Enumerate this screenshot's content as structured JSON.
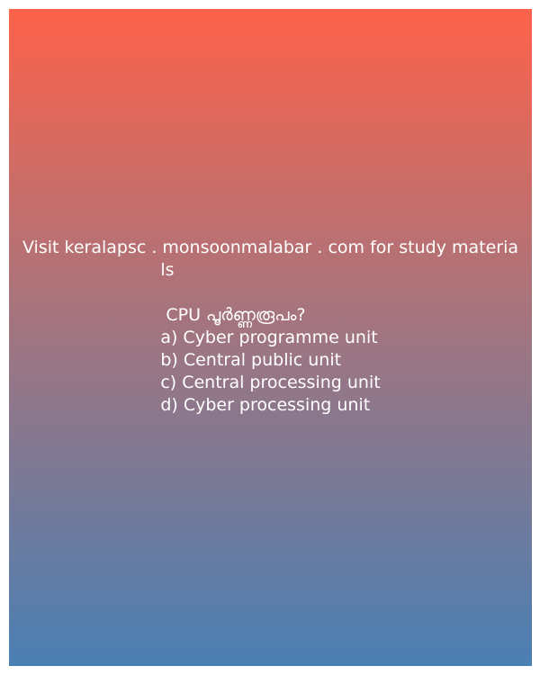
{
  "post": {
    "promo_line1": "Visit keralapsc . monsoonmalabar . com for study materia",
    "promo_line2": "ls",
    "question": " CPU പൂർണ്ണരൂപം?",
    "options": [
      "a) Cyber programme unit",
      "b) Central public unit",
      "c) Central processing unit",
      "d) Cyber processing unit"
    ],
    "gradient_colors": [
      "#fe624a",
      "#a8747c",
      "#4a7fb3"
    ],
    "text_color": "#ffffff"
  }
}
